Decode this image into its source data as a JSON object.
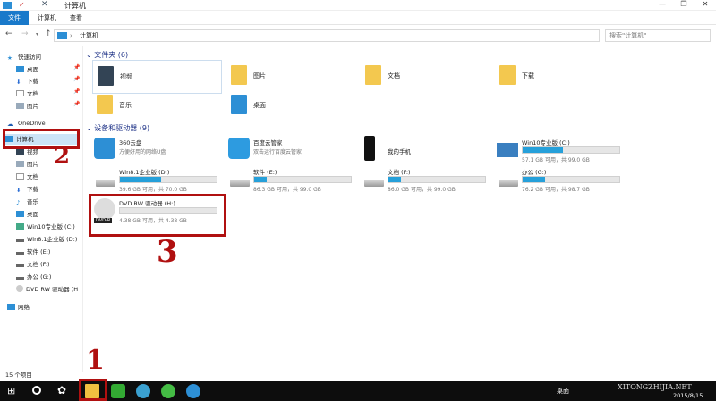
{
  "title": "计算机",
  "ribbon": {
    "tabs": [
      "文件",
      "计算机",
      "查看"
    ]
  },
  "address": {
    "path": "计算机",
    "search_placeholder": "搜索\"计算机\""
  },
  "sidebar": {
    "quick_access": "快速访问",
    "quick_items": [
      "桌面",
      "下载",
      "文档",
      "图片"
    ],
    "onedrive": "OneDrive",
    "computer": "计算机",
    "computer_items": [
      "视频",
      "图片",
      "文档",
      "下载",
      "音乐",
      "桌面",
      "Win10专业版 (C:)",
      "Win8.1企业版 (D:)",
      "软件 (E:)",
      "文档 (F:)",
      "办公 (G:)",
      "DVD RW 驱动器 (H"
    ],
    "network": "网络"
  },
  "folders": {
    "header": "文件夹 (6)",
    "items": [
      "视频",
      "图片",
      "文档",
      "下载",
      "音乐",
      "桌面"
    ]
  },
  "devices": {
    "header": "设备和驱动器 (9)",
    "apps": [
      {
        "name": "360云盘",
        "sub": "方便好用的网络U盘"
      },
      {
        "name": "百度云管家",
        "sub": "双击运行百度云管家"
      },
      {
        "name": "我的手机"
      }
    ],
    "drives": [
      {
        "name": "Win10专业版 (C:)",
        "cap": "57.1 GB 可用，共 99.0 GB",
        "used": 0.42
      },
      {
        "name": "Win8.1企业版 (D:)",
        "cap": "39.6 GB 可用，共 70.0 GB",
        "used": 0.43
      },
      {
        "name": "软件 (E:)",
        "cap": "86.3 GB 可用，共 99.0 GB",
        "used": 0.13
      },
      {
        "name": "文档 (F:)",
        "cap": "86.0 GB 可用，共 99.0 GB",
        "used": 0.13
      },
      {
        "name": "办公 (G:)",
        "cap": "76.2 GB 可用，共 98.7 GB",
        "used": 0.23
      },
      {
        "name": "DVD RW 驱动器 (H:)",
        "cap": "4.38 GB 可用，共 4.38 GB",
        "used": 0,
        "badge": "DVD-R"
      }
    ]
  },
  "annotations": [
    "1",
    "2",
    "3"
  ],
  "status": "15 个项目",
  "taskbar": {
    "desktop": "桌面",
    "date": "2015/8/15",
    "watermark": "XITONGZHIJIA.NET"
  }
}
